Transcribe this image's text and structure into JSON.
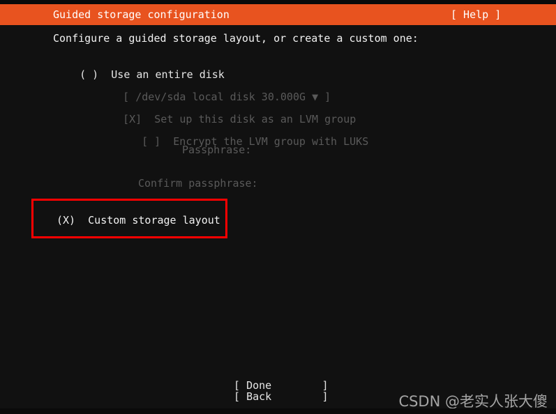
{
  "colors": {
    "header_bg": "#e8531f",
    "screen_bg": "#111111",
    "text": "#e6e6e6",
    "dim_text": "#5a5a5a",
    "highlight_border": "#ff0000",
    "watermark": "#b9b9b9"
  },
  "header": {
    "title": "Guided storage configuration",
    "help_label": "[ Help ]"
  },
  "main": {
    "prompt": "Configure a guided storage layout, or create a custom one:",
    "entire_disk_option": {
      "radio": "( )",
      "label": "Use an entire disk"
    },
    "disk_selector": {
      "open_bracket": "[",
      "value": "/dev/sda local disk 30.000G",
      "arrow": "▼",
      "close_bracket": "]"
    },
    "lvm_checkbox": {
      "box": "[X]",
      "label": "Set up this disk as an LVM group"
    },
    "luks_checkbox": {
      "box": "[ ]",
      "label": "Encrypt the LVM group with LUKS"
    },
    "passphrase_label": "Passphrase:",
    "confirm_passphrase_label": "Confirm passphrase:",
    "custom_layout_option": {
      "radio": "(X)",
      "label": "Custom storage layout"
    }
  },
  "footer": {
    "done": {
      "open": "[",
      "label": "Done",
      "close": "]"
    },
    "back": {
      "open": "[",
      "label": "Back",
      "close": "]"
    }
  },
  "watermark": {
    "text": "CSDN @老实人张大傻"
  }
}
